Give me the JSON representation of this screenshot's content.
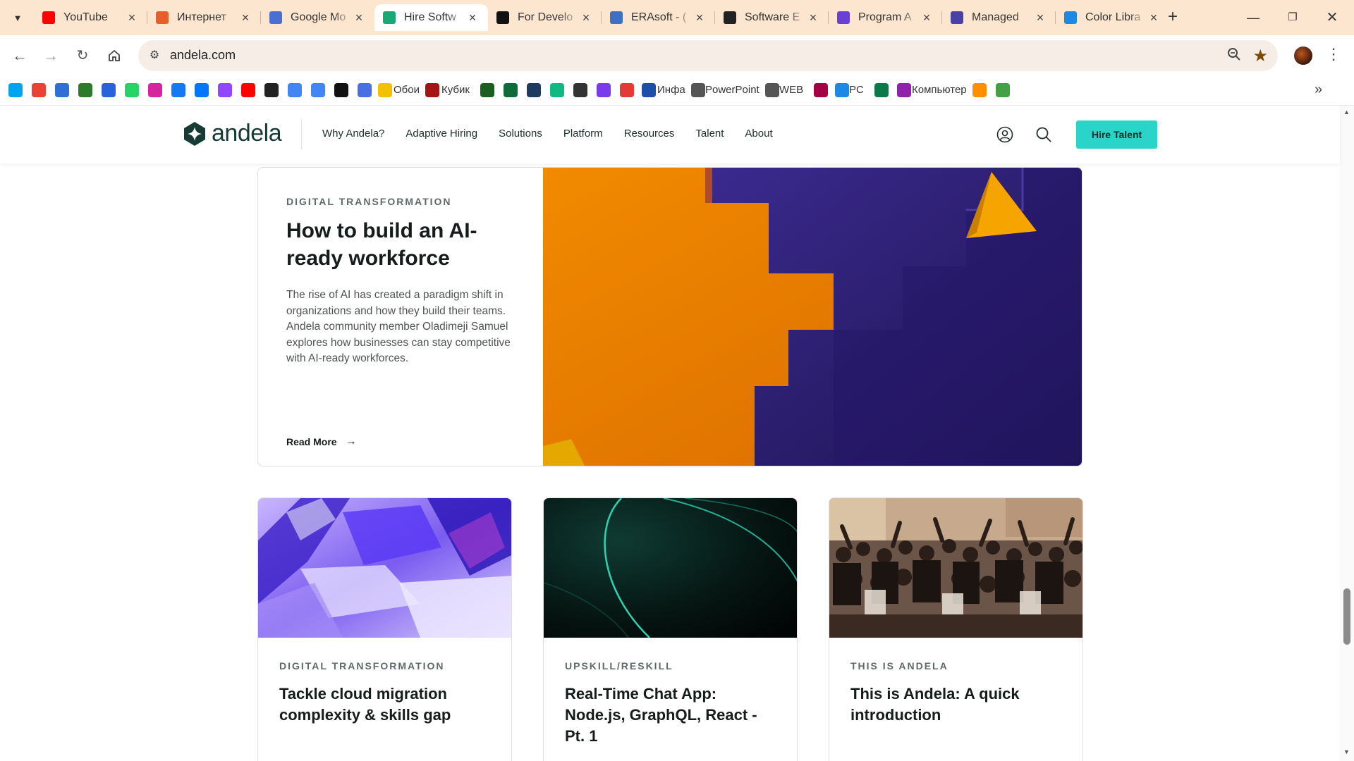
{
  "browser": {
    "tabs": [
      {
        "title": "YouTube",
        "icon": "youtube-icon",
        "color": "#ff0000"
      },
      {
        "title": "Интернет",
        "icon": "rainbow-icon",
        "color": "#e85d2a"
      },
      {
        "title": "Google Mo",
        "icon": "google-docs-icon",
        "color": "#4a6fd4"
      },
      {
        "title": "Hire Softw",
        "icon": "andela-icon",
        "color": "#19a974",
        "active": true
      },
      {
        "title": "For Develo",
        "icon": "b-icon",
        "color": "#111111"
      },
      {
        "title": "ERAsoft - (",
        "icon": "erasoft-icon",
        "color": "#3d6fc4"
      },
      {
        "title": "Software E",
        "icon": "square-icon",
        "color": "#222222"
      },
      {
        "title": "Program A",
        "icon": "program-icon",
        "color": "#6a3fd8"
      },
      {
        "title": "Managed",
        "icon": "cloud-icon",
        "color": "#4b3fa8"
      },
      {
        "title": "Color Libra",
        "icon": "color-library-icon",
        "color": "#1e88e5"
      }
    ],
    "url": "andela.com",
    "bookmarks": [
      {
        "icon": "windows-icon",
        "color": "#00a4ef",
        "label": ""
      },
      {
        "icon": "gmail-icon",
        "color": "#ea4335",
        "label": ""
      },
      {
        "icon": "google-sheets-icon",
        "color": "#2f6fd6",
        "label": ""
      },
      {
        "icon": "fnk-icon",
        "color": "#2d7a2d",
        "label": ""
      },
      {
        "icon": "d-icon",
        "color": "#2a62d8",
        "label": ""
      },
      {
        "icon": "whatsapp-icon",
        "color": "#25d366",
        "label": ""
      },
      {
        "icon": "instagram-icon",
        "color": "#d6249f",
        "label": ""
      },
      {
        "icon": "facebook-icon",
        "color": "#1877f2",
        "label": ""
      },
      {
        "icon": "vk-icon",
        "color": "#0077ff",
        "label": ""
      },
      {
        "icon": "twitch-icon",
        "color": "#9146ff",
        "label": ""
      },
      {
        "icon": "youtube-icon",
        "color": "#ff0000",
        "label": ""
      },
      {
        "icon": "u-icon",
        "color": "#222222",
        "label": ""
      },
      {
        "icon": "google-icon",
        "color": "#4285f4",
        "label": ""
      },
      {
        "icon": "translate-icon",
        "color": "#4285f4",
        "label": ""
      },
      {
        "icon": "chatgpt-icon",
        "color": "#111111",
        "label": ""
      },
      {
        "icon": "gemini-icon",
        "color": "#4a6fe0",
        "label": ""
      },
      {
        "icon": "pin-icon",
        "color": "#f2c200",
        "label": "Обои"
      },
      {
        "icon": "cube-icon",
        "color": "#a31515",
        "label": "Кубик"
      },
      {
        "icon": "stripes-icon",
        "color": "#1b5e20",
        "label": ""
      },
      {
        "icon": "e-icon",
        "color": "#0f6b3a",
        "label": ""
      },
      {
        "icon": "graduation-cap-icon",
        "color": "#1e3a5f",
        "label": ""
      },
      {
        "icon": "hexagon-icon",
        "color": "#10b981",
        "label": ""
      },
      {
        "icon": "m-icon",
        "color": "#333333",
        "label": ""
      },
      {
        "icon": "circle-u-icon",
        "color": "#7c3aed",
        "label": ""
      },
      {
        "icon": "a-icon",
        "color": "#e53935",
        "label": ""
      },
      {
        "icon": "book-icon",
        "color": "#1e4fa8",
        "label": "Инфа"
      },
      {
        "icon": "folder-icon",
        "color": "#555555",
        "label": "PowerPoint"
      },
      {
        "icon": "folder-icon",
        "color": "#555555",
        "label": "WEB"
      },
      {
        "icon": "barcelona-icon",
        "color": "#a50044",
        "label": ""
      },
      {
        "icon": "pc-icon",
        "color": "#1e88e5",
        "label": "PC"
      },
      {
        "icon": "globe-icon",
        "color": "#0b7a4b",
        "label": ""
      },
      {
        "icon": "computer-icon",
        "color": "#8e24aa",
        "label": "Компьютер"
      },
      {
        "icon": "diamond-icon",
        "color": "#ff8f00",
        "label": ""
      },
      {
        "icon": "diamond-icon",
        "color": "#43a047",
        "label": ""
      }
    ]
  },
  "site": {
    "logo_text": "andela",
    "nav": [
      "Why Andela?",
      "Adaptive Hiring",
      "Solutions",
      "Platform",
      "Resources",
      "Talent",
      "About"
    ],
    "cta": "Hire Talent",
    "accent_color": "#2ad4c8"
  },
  "featured": {
    "category": "DIGITAL TRANSFORMATION",
    "title": "How to build an AI-ready workforce",
    "excerpt": "The rise of AI has created a paradigm shift in organizations and how they build their teams. Andela community member Oladimeji Samuel explores how businesses can stay competitive with AI-ready workforces.",
    "read_more": "Read More"
  },
  "cards": [
    {
      "category": "DIGITAL TRANSFORMATION",
      "title": "Tackle cloud migration complexity & skills gap"
    },
    {
      "category": "UPSKILL/RESKILL",
      "title": "Real-Time Chat App: Node.js, GraphQL, React - Pt. 1"
    },
    {
      "category": "THIS IS ANDELA",
      "title": "This is Andela: A quick introduction"
    }
  ]
}
